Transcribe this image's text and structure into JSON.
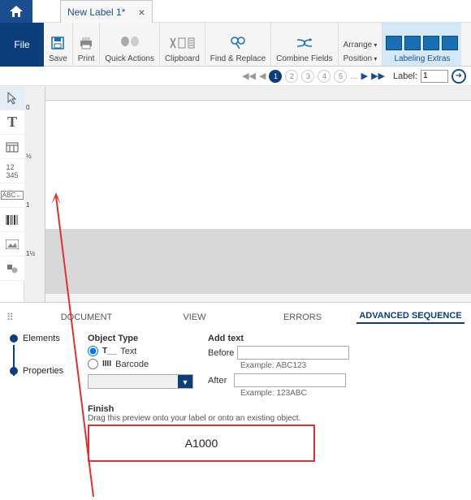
{
  "titlebar": {
    "doc_name": "New Label 1*"
  },
  "ribbon": {
    "file": "File",
    "save": "Save",
    "print": "Print",
    "quick_actions": "Quick Actions",
    "clipboard": "Clipboard",
    "find_replace": "Find & Replace",
    "combine_fields": "Combine Fields",
    "arrange": "Arrange",
    "position": "Position",
    "labeling_extras": "Labeling Extras"
  },
  "navbar": {
    "pages": [
      "1",
      "2",
      "3",
      "4",
      "5"
    ],
    "ellipsis": "...",
    "label_text": "Label:",
    "label_value": "1"
  },
  "panel": {
    "tabs": {
      "document": "DOCUMENT",
      "view": "VIEW",
      "errors": "ERRORS",
      "advanced": "ADVANCED SEQUENCE"
    },
    "rail": {
      "elements": "Elements",
      "properties": "Properties"
    },
    "objtype": {
      "hdr": "Object Type",
      "text": "Text",
      "barcode": "Barcode"
    },
    "addtext": {
      "hdr": "Add text",
      "before": "Before",
      "after": "After",
      "ex_before": "Example: ABC123",
      "ex_after": "Example: 123ABC"
    },
    "finish": {
      "hdr": "Finish",
      "hint": "Drag this preview onto your label or onto an existing object.",
      "preview": "A1000"
    }
  }
}
